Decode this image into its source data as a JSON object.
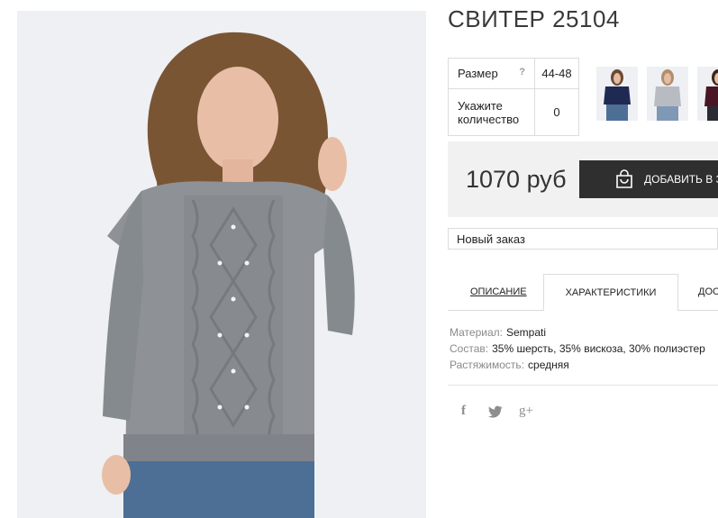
{
  "product": {
    "title": "СВИТЕР 25104"
  },
  "params": {
    "size_label": "Размер",
    "size_help": "?",
    "size_value": "44-48",
    "qty_label": "Укажите количество",
    "qty_value": "0"
  },
  "thumbnails": [
    {
      "name": "thumb-navy-sweater",
      "color": "#1f2a52"
    },
    {
      "name": "thumb-grey-sweater",
      "color": "#b8bcc2"
    },
    {
      "name": "thumb-burgundy-sweater",
      "color": "#4a1626"
    }
  ],
  "buy": {
    "price": "1070 руб",
    "add_to_cart_label": "ДОБАВИТЬ В З"
  },
  "order": {
    "selected": "Новый заказ"
  },
  "tabs": [
    {
      "label": "ОПИСАНИЕ"
    },
    {
      "label": "ХАРАКТЕРИСТИКИ"
    },
    {
      "label": "ДОС"
    }
  ],
  "specs": [
    {
      "key": "Материал:",
      "value": "Sempati"
    },
    {
      "key": "Состав:",
      "value": "35% шерсть, 35% вискоза, 30% полиэстер"
    },
    {
      "key": "Растяжимость:",
      "value": "средняя"
    }
  ],
  "social": {
    "facebook": "f",
    "twitter": "twitter-bird",
    "googleplus": "g+"
  },
  "colors": {
    "sweater": "#8e9297",
    "button_bg": "#2f2f2f",
    "buybox_bg": "#f1f1f1"
  }
}
